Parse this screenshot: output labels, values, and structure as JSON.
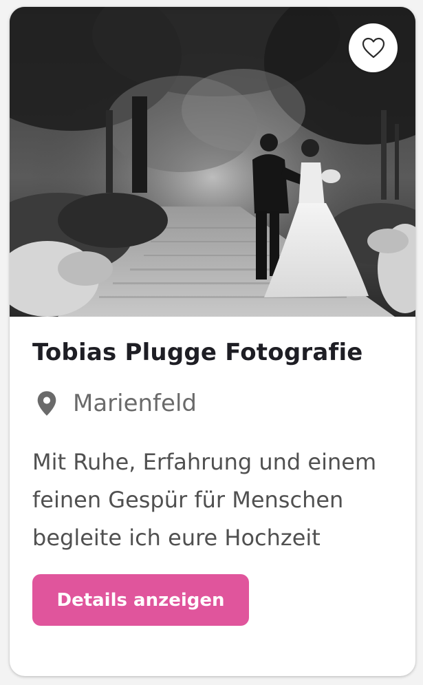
{
  "card": {
    "title": "Tobias Plugge Fotografie",
    "location": "Marienfeld",
    "description": "Mit Ruhe, Erfahrung und einem feinen Gespür für Menschen begleite ich eure Hochzeit",
    "details_button_label": "Details anzeigen",
    "favorite_icon": "heart-outline-icon",
    "location_icon": "map-pin-icon",
    "photo_alt": "Brautpaar auf einem Weg im Park"
  },
  "colors": {
    "accent": "#e0559c",
    "title": "#1e1e24",
    "text": "#505050",
    "muted": "#6a6a6a"
  }
}
